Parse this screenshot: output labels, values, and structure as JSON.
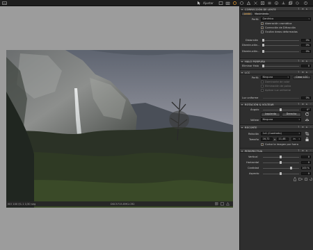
{
  "titlebar": {
    "adjust_label": "Ajustar"
  },
  "status": {
    "left": "ISO 100  f/1.1  1/30 seg",
    "center": "DSC5715-EMG.CR2"
  },
  "lens": {
    "section_title": "CORRECCIÓN DE LENTE",
    "tab_lens": "Lente",
    "tab_movement": "Movimiento",
    "profile_label": "Perfil:",
    "profile_value": "Genérico",
    "cb_chromatic": "Aberración cromática",
    "cb_diffraction": "Corrección de Difracción",
    "cb_hide_areas": "Ocultar áreas deformadas",
    "distortion_label": "Distorsión",
    "distortion_value": "0%",
    "falloff_label": "Disminución...",
    "falloff_value": "0%",
    "falloff2_label": "Disminución...",
    "falloff2_value": "0%"
  },
  "purple": {
    "section_title": "HALO PÚRPURA",
    "remove_label": "Eliminar Halo",
    "remove_value": "0"
  },
  "lcc": {
    "section_title": "LCC",
    "profile_label": "Perfil:",
    "profile_value": "Ninguna",
    "create_btn": "Crear LCC",
    "opt_cast": "Dominante de color",
    "opt_dust": "Eliminación de polvo",
    "opt_uniform": "Aplicar Luz uniforme",
    "uniform_label": "Luz uniforme",
    "uniform_value": "0%"
  },
  "rotation": {
    "section_title": "ROTACIÓN & VOLTEAR",
    "angle_label": "Ángulo",
    "angle_value": "0°",
    "left_btn": "Izquierda",
    "right_btn": "Derecha",
    "flip_label": "Voltear",
    "flip_value": "Ninguna"
  },
  "crop": {
    "section_title": "RECORTE",
    "ratio_label": "Relación",
    "ratio_value": "1x1 (Cuadrado)",
    "size_label": "Tamaño",
    "width_value": "16,72",
    "x_sep": "x",
    "height_value": "11,48",
    "unit_value": "in",
    "cb_outside": "Cortar la imagen por fuera"
  },
  "perspective": {
    "section_title": "PERSPECTIVA",
    "vertical_label": "Vertical",
    "vertical_value": "0",
    "horizontal_label": "Horizontal",
    "horizontal_value": "0",
    "amount_label": "Cantidad",
    "amount_value": "100 %",
    "aspect_label": "Aspecto",
    "aspect_value": "0"
  }
}
